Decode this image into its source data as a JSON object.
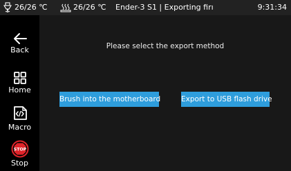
{
  "status_bar": {
    "nozzle_temp": "26/26 ℃",
    "bed_temp": "26/26 ℃",
    "title": "Ender-3 S1 | Exporting firı",
    "time": "9:31:34"
  },
  "sidebar": {
    "items": [
      {
        "label": "Back",
        "icon": "back-arrow-icon"
      },
      {
        "label": "Home",
        "icon": "home-grid-icon"
      },
      {
        "label": "Macro",
        "icon": "macro-code-icon"
      },
      {
        "label": "Stop",
        "icon": "stop-icon"
      }
    ],
    "stop_icon_text": "STOP"
  },
  "main": {
    "prompt": "Please select the export method",
    "buttons": [
      {
        "label": "Brush into the motherboard"
      },
      {
        "label": "Export to USB flash drive"
      }
    ]
  },
  "colors": {
    "accent": "#2e9ddc",
    "stop": "#e0242a",
    "background": "#181818",
    "status_bar": "#222222"
  }
}
